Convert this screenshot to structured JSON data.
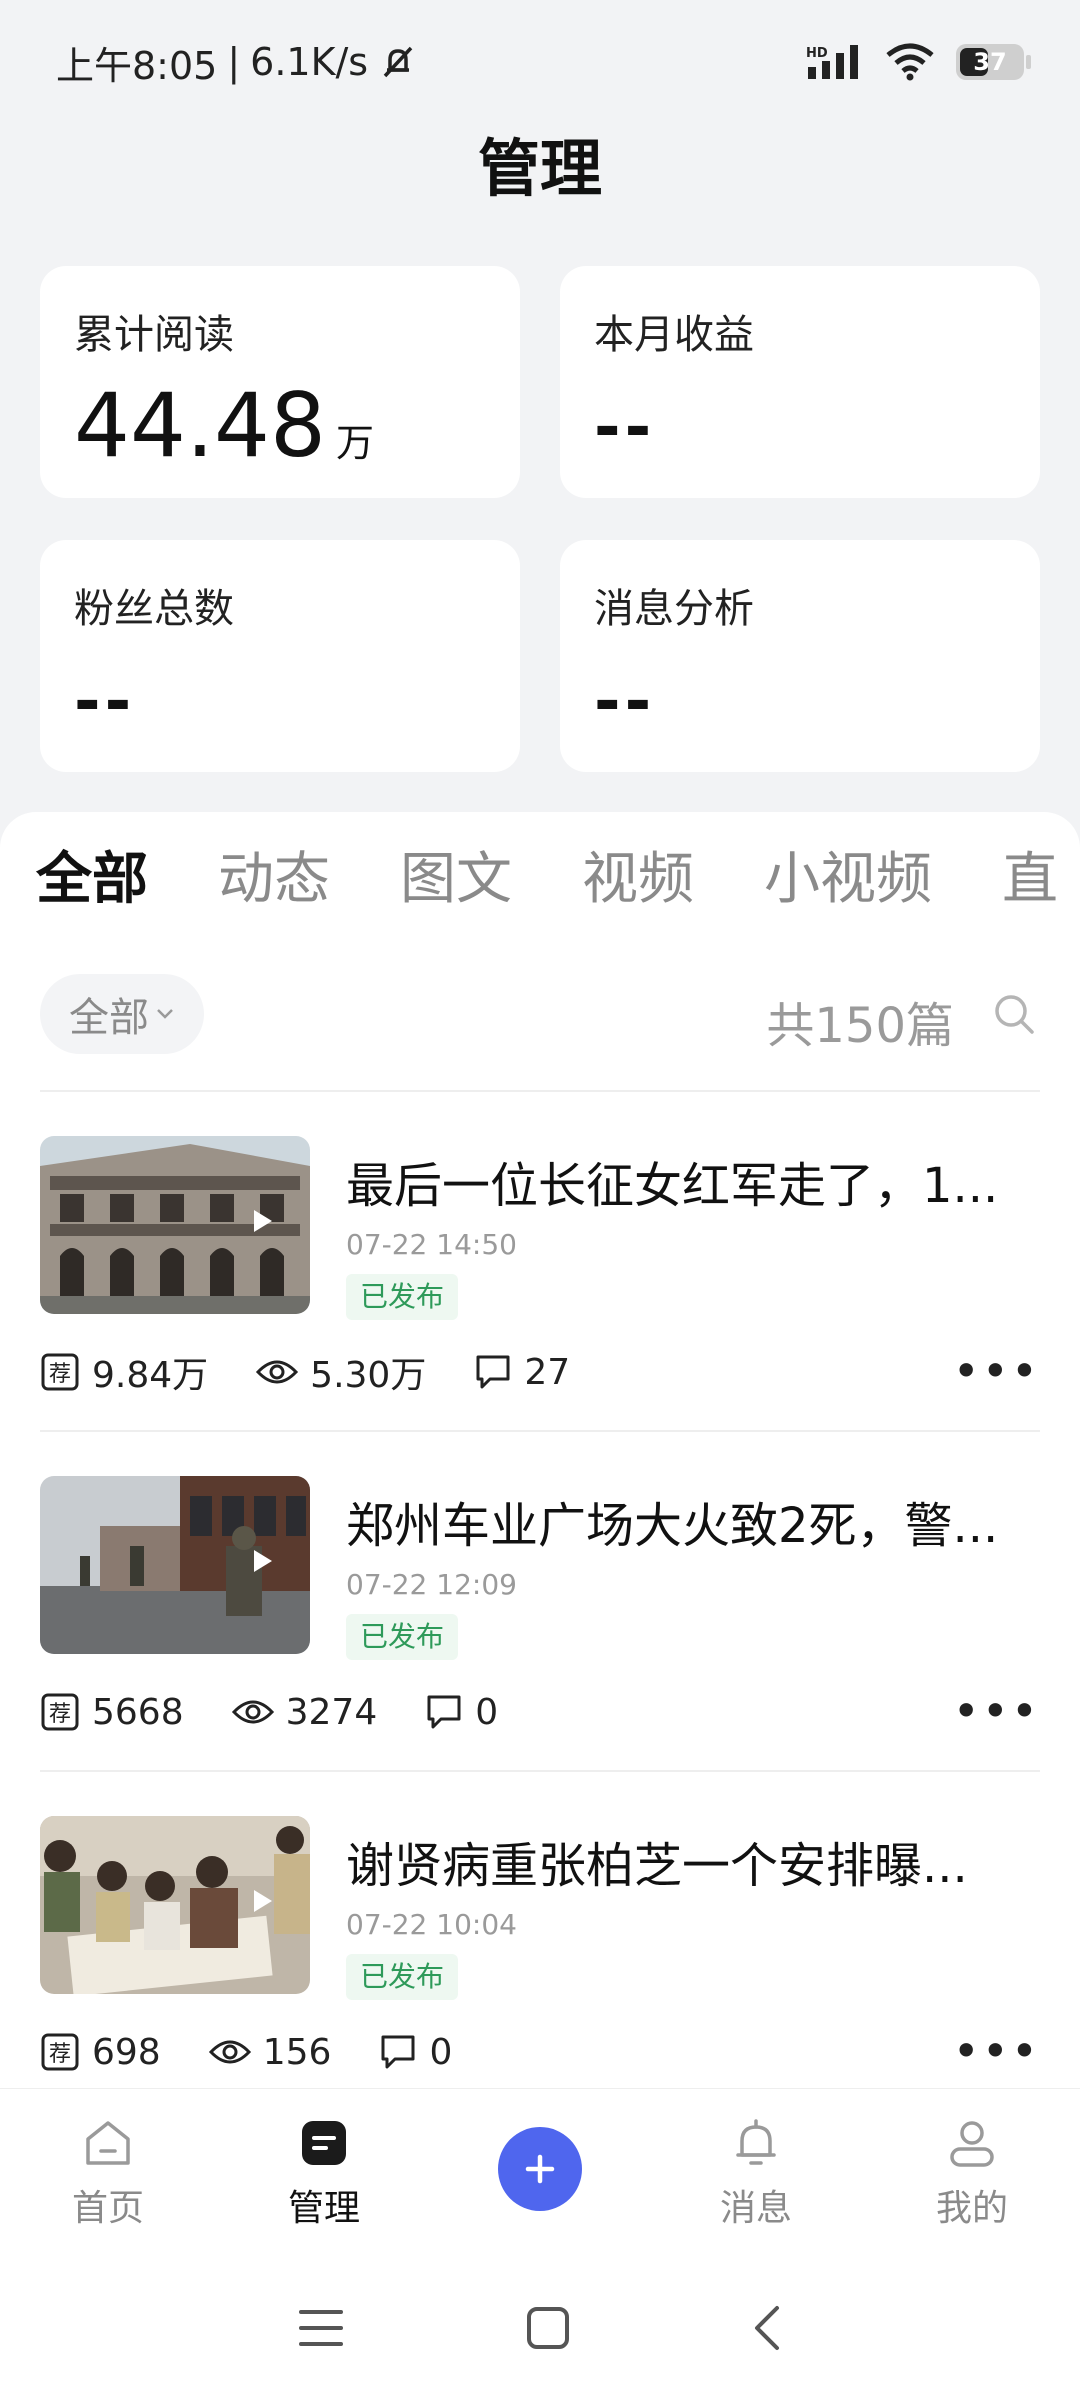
{
  "status_bar": {
    "time": "上午8:05",
    "separator": "|",
    "speed": "6.1K/s",
    "battery": "37"
  },
  "page_title": "管理",
  "stats": [
    {
      "label": "累计阅读",
      "value": "44.48",
      "unit": "万"
    },
    {
      "label": "本月收益",
      "value": "--"
    },
    {
      "label": "粉丝总数",
      "value": "--"
    },
    {
      "label": "消息分析",
      "value": "--"
    }
  ],
  "tabs": [
    "全部",
    "动态",
    "图文",
    "视频",
    "小视频",
    "直"
  ],
  "filter": {
    "label": "全部",
    "count_text": "共150篇"
  },
  "articles": [
    {
      "title": "最后一位长征女红军走了，1...",
      "date": "07-22 14:50",
      "status": "已发布",
      "recommend": "9.84万",
      "views": "5.30万",
      "comments": "27"
    },
    {
      "title": "郑州车业广场大火致2死，警...",
      "date": "07-22 12:09",
      "status": "已发布",
      "recommend": "5668",
      "views": "3274",
      "comments": "0"
    },
    {
      "title": "谢贤病重张柏芝一个安排曝...",
      "date": "07-22 10:04",
      "status": "已发布",
      "recommend": "698",
      "views": "156",
      "comments": "0"
    }
  ],
  "recommend_badge": "荐",
  "bottom_nav": [
    {
      "label": "首页",
      "icon": "home-icon"
    },
    {
      "label": "管理",
      "icon": "manage-icon"
    },
    {
      "label": "",
      "icon": "add-icon"
    },
    {
      "label": "消息",
      "icon": "bell-icon"
    },
    {
      "label": "我的",
      "icon": "user-icon"
    }
  ],
  "colors": {
    "accent": "#4f66ee",
    "published": "#2e9a5a",
    "background": "#f2f3f5"
  }
}
